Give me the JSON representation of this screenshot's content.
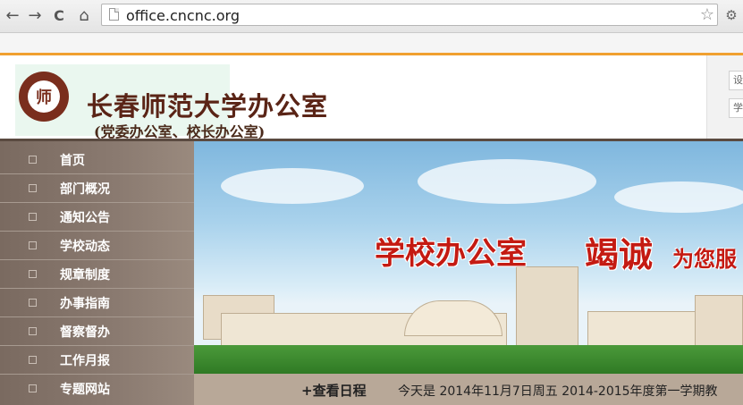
{
  "browser": {
    "url": "office.cncnc.org",
    "back_glyph": "←",
    "forward_glyph": "→",
    "reload_glyph": "C",
    "home_glyph": "⌂",
    "star_glyph": "☆",
    "menu_glyph": "⚙"
  },
  "header": {
    "title": "长春师范大学办公室",
    "subtitle": "(党委办公室、校长办公室)",
    "right_boxes": [
      "设",
      "学"
    ]
  },
  "sidebar": {
    "items": [
      {
        "label": "首页"
      },
      {
        "label": "部门概况"
      },
      {
        "label": "通知公告"
      },
      {
        "label": "学校动态"
      },
      {
        "label": "规章制度"
      },
      {
        "label": "办事指南"
      },
      {
        "label": "督察督办"
      },
      {
        "label": "工作月报"
      },
      {
        "label": "专题网站"
      }
    ]
  },
  "banner": {
    "slogan_main": "学校办公室",
    "slogan_emph": "竭诚",
    "slogan_tail": "为您服"
  },
  "status": {
    "schedule_link": "+查看日程",
    "today": "今天是  2014年11月7日周五   2014-2015年度第一学期教"
  },
  "colors": {
    "accent_orange": "#f0a030",
    "brand_red": "#c41a12",
    "sidebar_brown": "#8a7a70"
  }
}
